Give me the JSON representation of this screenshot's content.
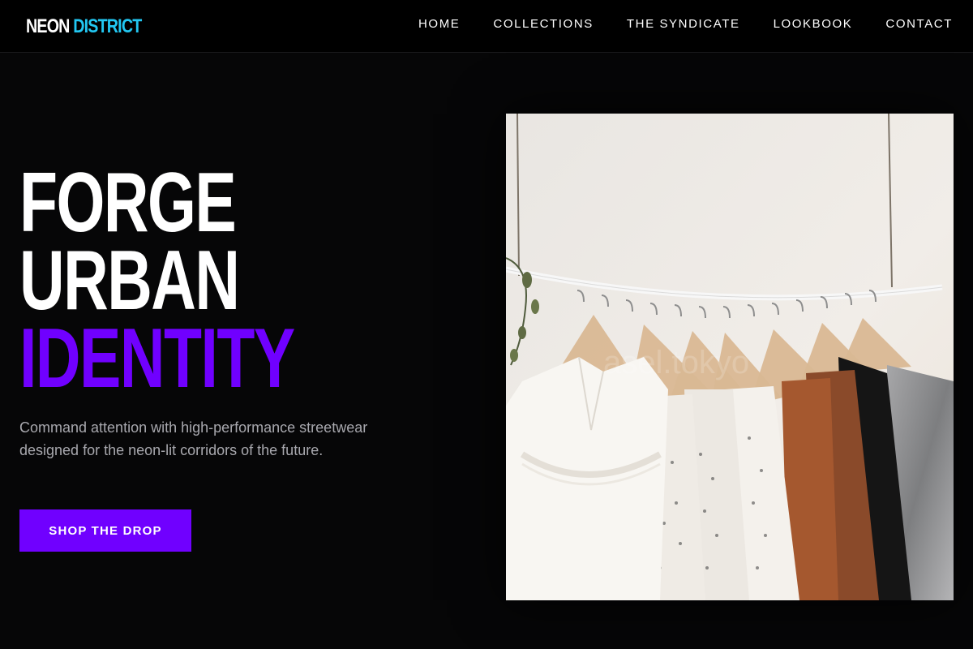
{
  "brand": {
    "name_part1": "NEON",
    "name_part2": "DISTRICT"
  },
  "nav": {
    "items": [
      {
        "label": "HOME"
      },
      {
        "label": "COLLECTIONS"
      },
      {
        "label": "THE SYNDICATE"
      },
      {
        "label": "LOOKBOOK"
      },
      {
        "label": "CONTACT"
      }
    ]
  },
  "hero": {
    "headline_line1": "FORGE",
    "headline_line2": "URBAN",
    "headline_line3": "IDENTITY",
    "lead": "Command attention with high-performance streetwear designed for the neon-lit corridors of the future.",
    "cta_label": "SHOP THE DROP"
  },
  "image": {
    "subject": "clothing-rack-photo"
  },
  "colors": {
    "background": "#060607",
    "header_background": "#000000",
    "accent_purple": "#7000ff",
    "accent_cyan": "#22c7f2",
    "lead_text": "#a8a8ae"
  }
}
